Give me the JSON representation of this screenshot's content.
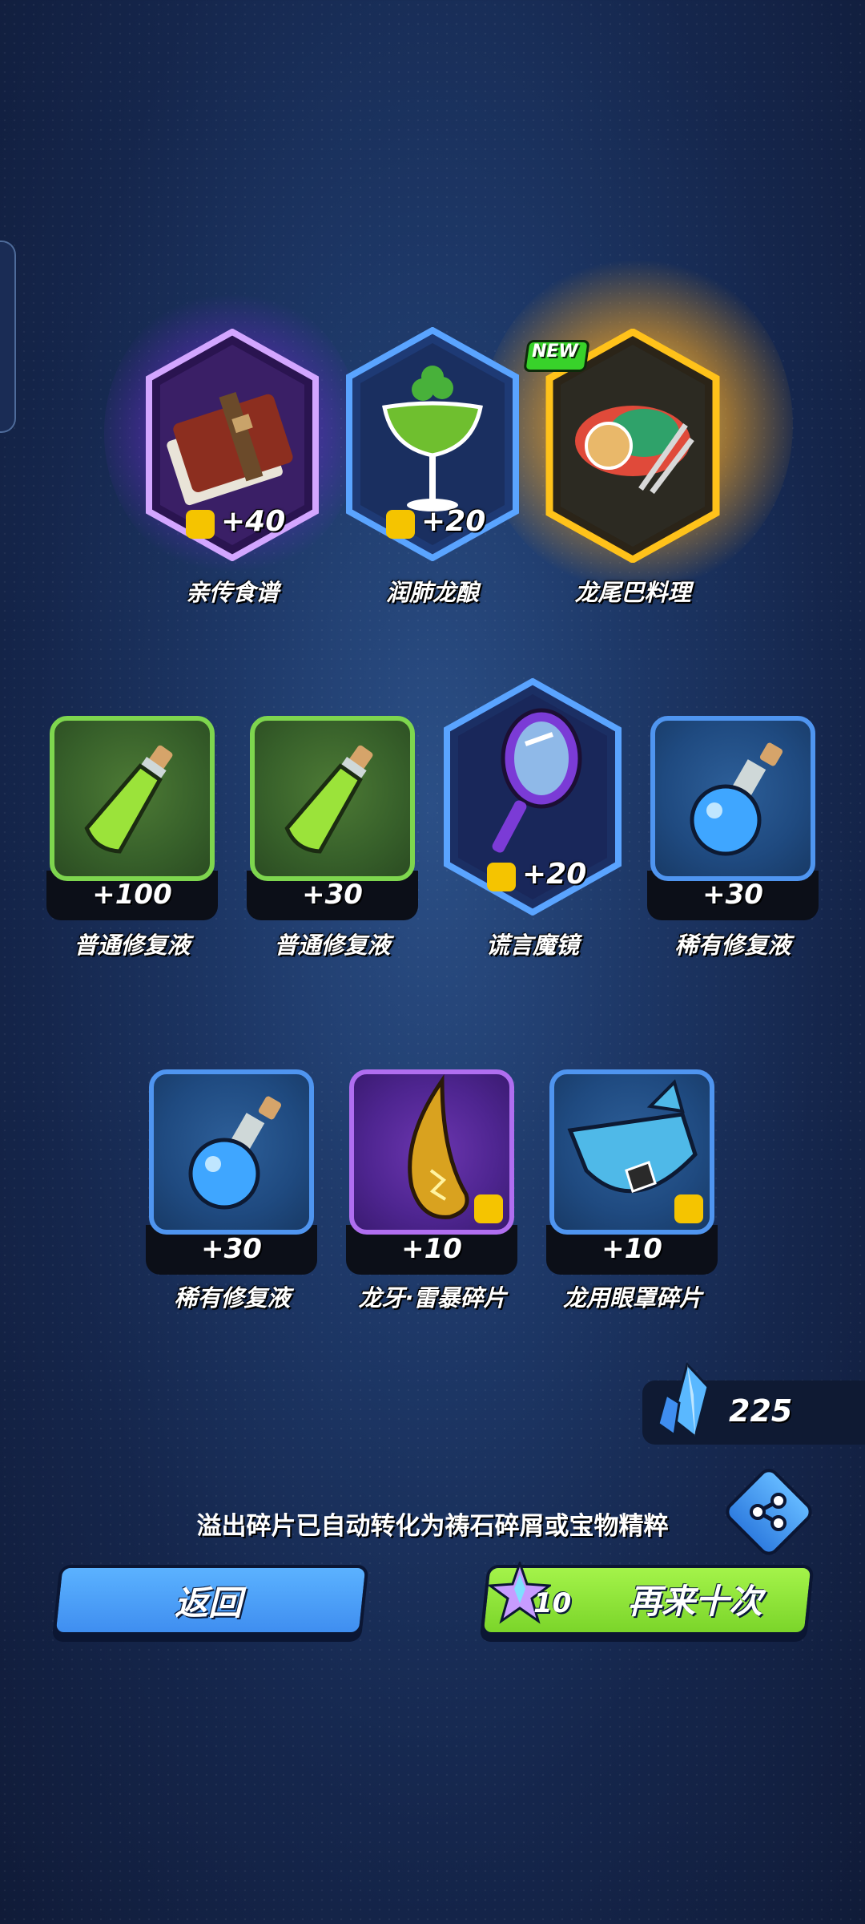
{
  "featured": [
    {
      "name": "亲传食谱",
      "amount": "+40",
      "rarity": "epic",
      "icon": "recipe-book-icon",
      "color": "#a855f7"
    },
    {
      "name": "润肺龙酿",
      "amount": "+20",
      "rarity": "rare",
      "icon": "cocktail-glass-icon",
      "color": "#4f95f0"
    },
    {
      "name": "龙尾巴料理",
      "amount": "",
      "rarity": "legendary",
      "icon": "dragon-tail-dish-icon",
      "color": "#ffc21a",
      "badge": "NEW"
    }
  ],
  "row2": [
    {
      "name": "普通修复液",
      "amount": "+100",
      "frame": "green",
      "icon": "green-potion-icon"
    },
    {
      "name": "普通修复液",
      "amount": "+30",
      "frame": "green",
      "icon": "green-potion-icon"
    },
    {
      "name": "谎言魔镜",
      "amount": "+20",
      "frame": "hex-blue",
      "icon": "magic-mirror-icon"
    },
    {
      "name": "稀有修复液",
      "amount": "+30",
      "frame": "blue",
      "icon": "blue-potion-icon"
    }
  ],
  "row3": [
    {
      "name": "稀有修复液",
      "amount": "+30",
      "frame": "blue",
      "icon": "blue-potion-icon"
    },
    {
      "name": "龙牙·雷暴碎片",
      "amount": "+10",
      "frame": "purple",
      "icon": "dragon-fang-icon"
    },
    {
      "name": "龙用眼罩碎片",
      "amount": "+10",
      "frame": "blue",
      "icon": "dragon-eyepatch-icon"
    }
  ],
  "currency": {
    "value": "225",
    "icon": "crystal-icon"
  },
  "notice": "溢出碎片已自动转化为祷石碎屑或宝物精粹",
  "buttons": {
    "back_label": "返回",
    "again_label": "再来十次",
    "again_cost": "10"
  },
  "colors": {
    "back": "#4aa0fa",
    "again": "#8ee33a",
    "accent_gold": "#ffc21a"
  }
}
